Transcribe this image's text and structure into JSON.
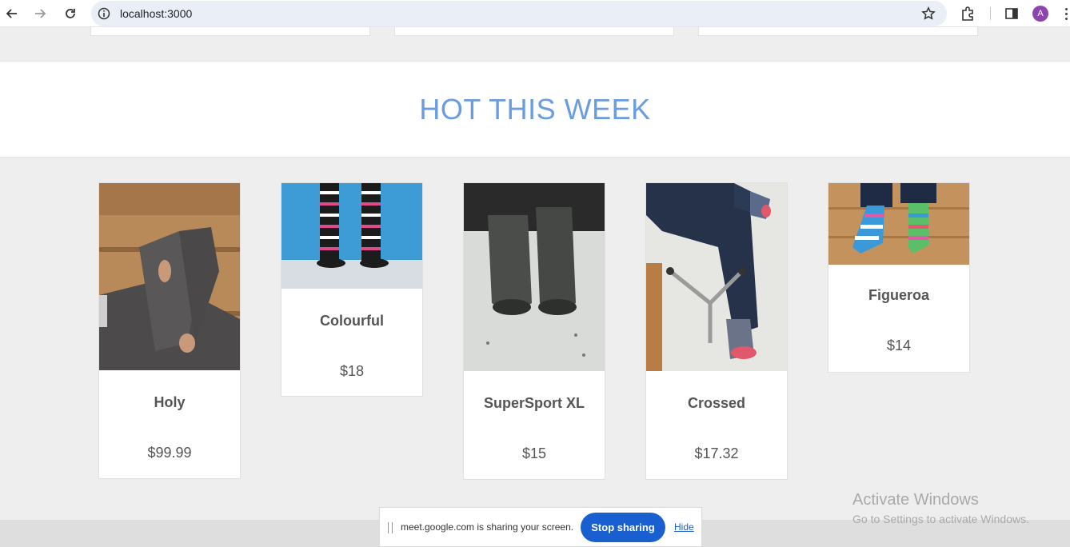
{
  "browser": {
    "url": "localhost:3000",
    "avatar_initial": "A"
  },
  "section": {
    "title": "HOT THIS WEEK"
  },
  "products": [
    {
      "name": "Holy",
      "price": "$99.99"
    },
    {
      "name": "Colourful",
      "price": "$18"
    },
    {
      "name": "SuperSport XL",
      "price": "$15"
    },
    {
      "name": "Crossed",
      "price": "$17.32"
    },
    {
      "name": "Figueroa",
      "price": "$14"
    }
  ],
  "share_bar": {
    "message": "meet.google.com is sharing your screen.",
    "stop_label": "Stop sharing",
    "hide_label": "Hide"
  },
  "watermark": {
    "line1": "Activate Windows",
    "line2": "Go to Settings to activate Windows."
  },
  "colors": {
    "accent": "#6b9be0",
    "stop_button": "#1a5fd0"
  }
}
